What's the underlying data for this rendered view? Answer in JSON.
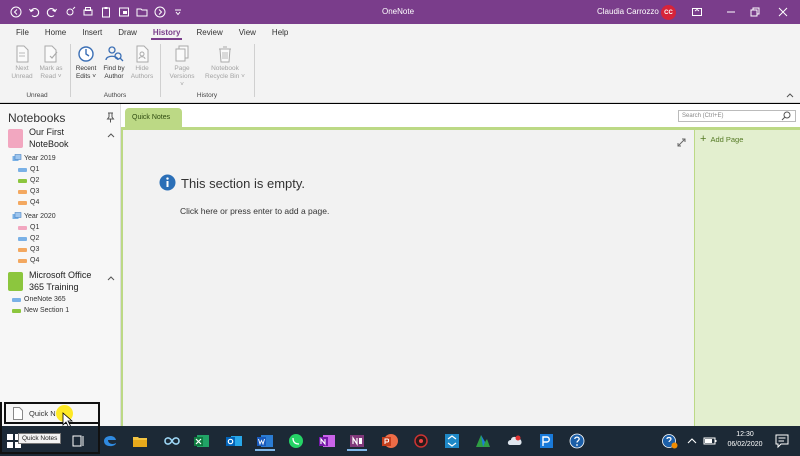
{
  "window": {
    "app_title": "OneNote",
    "user_name": "Claudia Carrozzo",
    "user_initials": "CC"
  },
  "quick_access": [
    "back-icon",
    "undo-icon",
    "redo-icon",
    "sync-icon",
    "print-icon",
    "clipboard-icon",
    "view-icon",
    "folder-icon",
    "forward-icon",
    "customize-icon"
  ],
  "menu": {
    "tabs": [
      {
        "label": "File",
        "active": false
      },
      {
        "label": "Home",
        "active": false
      },
      {
        "label": "Insert",
        "active": false
      },
      {
        "label": "Draw",
        "active": false
      },
      {
        "label": "History",
        "active": true
      },
      {
        "label": "Review",
        "active": false
      },
      {
        "label": "View",
        "active": false
      },
      {
        "label": "Help",
        "active": false
      }
    ]
  },
  "ribbon": {
    "groups": [
      {
        "label": "Unread",
        "buttons": [
          {
            "label": "Next\nUnread",
            "icon": "next-unread-icon",
            "enabled": false
          },
          {
            "label": "Mark as\nRead ˅",
            "icon": "mark-read-icon",
            "enabled": false
          }
        ]
      },
      {
        "label": "Authors",
        "buttons": [
          {
            "label": "Recent\nEdits ˅",
            "icon": "recent-edits-icon",
            "enabled": true
          },
          {
            "label": "Find by\nAuthor",
            "icon": "find-author-icon",
            "enabled": true
          },
          {
            "label": "Hide\nAuthors",
            "icon": "hide-authors-icon",
            "enabled": false
          }
        ]
      },
      {
        "label": "History",
        "buttons": [
          {
            "label": "Page\nVersions ˅",
            "icon": "page-versions-icon",
            "enabled": false
          },
          {
            "label": "Notebook\nRecycle Bin ˅",
            "icon": "recycle-bin-icon",
            "enabled": false
          }
        ]
      }
    ]
  },
  "notebooks": {
    "header": "Notebooks",
    "items": [
      {
        "name": "Our First\nNoteBook",
        "color": "#f2a7c0",
        "groups": [
          {
            "name": "Year 2019",
            "sections": [
              {
                "name": "Q1",
                "color": "#7ab1e6"
              },
              {
                "name": "Q2",
                "color": "#8cc63e"
              },
              {
                "name": "Q3",
                "color": "#f3a860"
              },
              {
                "name": "Q4",
                "color": "#f3a860"
              }
            ]
          },
          {
            "name": "Year 2020",
            "sections": [
              {
                "name": "Q1",
                "color": "#f2a7c0"
              },
              {
                "name": "Q2",
                "color": "#7ab1e6"
              },
              {
                "name": "Q3",
                "color": "#f3a860"
              },
              {
                "name": "Q4",
                "color": "#f3a860"
              }
            ]
          }
        ]
      },
      {
        "name": "Microsoft Office\n365 Training",
        "color": "#8cc63e",
        "sections": [
          {
            "name": "OneNote 365",
            "color": "#7ab1e6"
          },
          {
            "name": "New Section 1",
            "color": "#8cc63e"
          }
        ]
      }
    ],
    "quick_notes_label": "Quick N"
  },
  "section_tab": {
    "label": "Quick Notes",
    "color": "#bcd985"
  },
  "search": {
    "placeholder": "Search (Ctrl+E)"
  },
  "canvas": {
    "empty_title": "This section is empty.",
    "empty_hint": "Click here or press enter to add a page."
  },
  "pages": {
    "add_page_label": "Add Page"
  },
  "taskbar": {
    "tooltip": "Quick Notes",
    "time": "12:30",
    "date": "06/02/2020",
    "apps": [
      "start-icon",
      "task-view-icon",
      "edge-icon",
      "file-explorer-icon",
      "infinity-icon",
      "excel-icon",
      "outlook-icon",
      "word-icon",
      "whatsapp-icon",
      "onenote-icon",
      "onenote-app-icon",
      "powerpoint-icon",
      "camera-icon",
      "app-icon",
      "maps-icon",
      "cloud-icon",
      "publisher-icon",
      "help-icon"
    ]
  }
}
